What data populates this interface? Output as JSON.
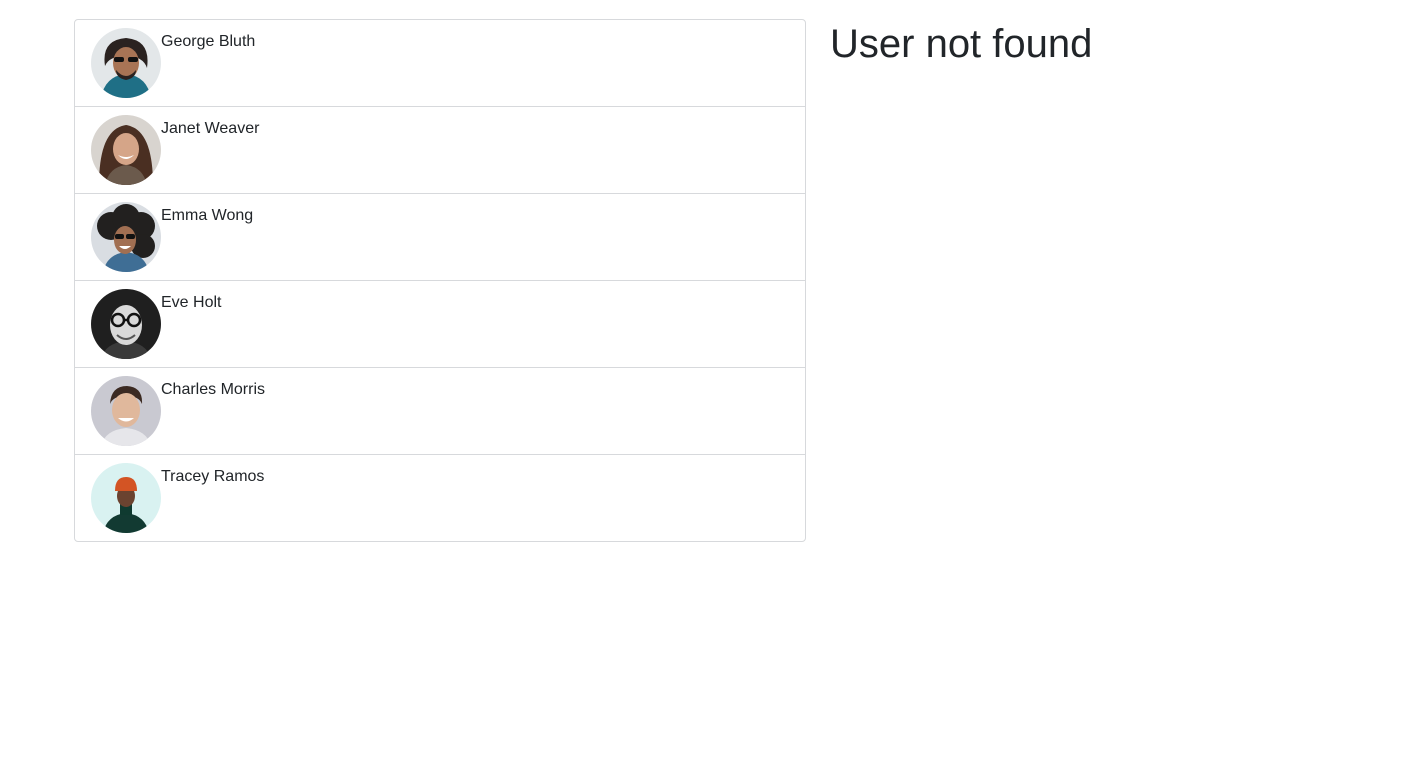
{
  "users": [
    {
      "name": "George Bluth",
      "avatar": "avatar-photo-george-bluth"
    },
    {
      "name": "Janet Weaver",
      "avatar": "avatar-photo-janet-weaver"
    },
    {
      "name": "Emma Wong",
      "avatar": "avatar-photo-emma-wong"
    },
    {
      "name": "Eve Holt",
      "avatar": "avatar-photo-eve-holt"
    },
    {
      "name": "Charles Morris",
      "avatar": "avatar-photo-charles-morris"
    },
    {
      "name": "Tracey Ramos",
      "avatar": "avatar-photo-tracey-ramos"
    }
  ],
  "detail": {
    "title": "User not found"
  },
  "colors": {
    "border": "#d7d9dc",
    "text": "#212529",
    "background": "#ffffff"
  }
}
